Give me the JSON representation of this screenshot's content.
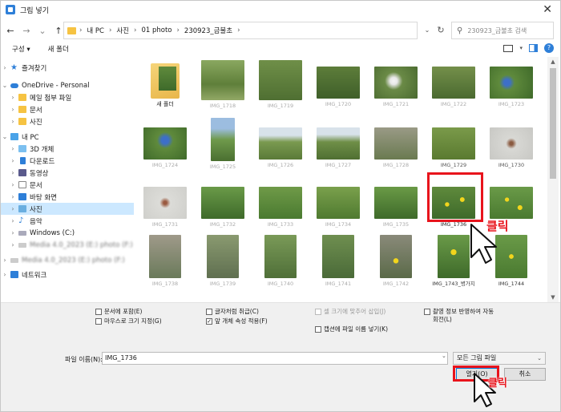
{
  "window": {
    "title": "그림 넣기"
  },
  "nav": {
    "back": "←",
    "forward": "→",
    "recent": "⌄",
    "up": "↑",
    "breadcrumb": [
      "내 PC",
      "사진",
      "01 photo",
      "230923_금불초"
    ],
    "refresh": "↻",
    "search_placeholder": "230923_금불초 검색"
  },
  "toolbar": {
    "organize": "구성 ▾",
    "new_folder": "새 폴더"
  },
  "sidebar": {
    "items": [
      {
        "label": "즐겨찾기",
        "icon": "star-icon"
      },
      {
        "label": "OneDrive - Personal",
        "icon": "cloud-icon"
      },
      {
        "label": "메일 첨부 파일",
        "icon": "folder-icon"
      },
      {
        "label": "문서",
        "icon": "folder-icon"
      },
      {
        "label": "사진",
        "icon": "folder-icon"
      },
      {
        "label": "내 PC",
        "icon": "computer-icon"
      },
      {
        "label": "3D 개체",
        "icon": "cube-icon"
      },
      {
        "label": "다운로드",
        "icon": "download-icon"
      },
      {
        "label": "동영상",
        "icon": "video-icon"
      },
      {
        "label": "문서",
        "icon": "document-icon"
      },
      {
        "label": "바탕 화면",
        "icon": "desktop-icon"
      },
      {
        "label": "사진",
        "icon": "pictures-icon"
      },
      {
        "label": "음악",
        "icon": "music-icon"
      },
      {
        "label": "Windows (C:)",
        "icon": "drive-icon"
      },
      {
        "label": "Media 4.0_2023 (E:) photo (F:)",
        "icon": "drive-icon"
      },
      {
        "label": "Media 4.0_2023 (E:) photo (F:)",
        "icon": "drive-icon"
      },
      {
        "label": "네트워크",
        "icon": "network-icon"
      }
    ]
  },
  "files": [
    {
      "label": "새 폴더"
    },
    {
      "label": "IMG_1718"
    },
    {
      "label": "IMG_1719"
    },
    {
      "label": "IMG_1720"
    },
    {
      "label": "IMG_1721"
    },
    {
      "label": "IMG_1722"
    },
    {
      "label": "IMG_1723"
    },
    {
      "label": "IMG_1724"
    },
    {
      "label": "IMG_1725"
    },
    {
      "label": "IMG_1726"
    },
    {
      "label": "IMG_1727"
    },
    {
      "label": "IMG_1728"
    },
    {
      "label": "IMG_1729"
    },
    {
      "label": "IMG_1730"
    },
    {
      "label": "IMG_1731"
    },
    {
      "label": "IMG_1732"
    },
    {
      "label": "IMG_1733"
    },
    {
      "label": "IMG_1734"
    },
    {
      "label": "IMG_1735"
    },
    {
      "label": "IMG_1736"
    },
    {
      "label": ""
    },
    {
      "label": "IMG_1738"
    },
    {
      "label": "IMG_1739"
    },
    {
      "label": "IMG_1740"
    },
    {
      "label": "IMG_1741"
    },
    {
      "label": "IMG_1742"
    },
    {
      "label": "IMG_1743_병가지"
    },
    {
      "label": "IMG_1744"
    }
  ],
  "options": {
    "opt1": "문서에 포함(E)",
    "opt2": "마우스로 크기 지정(G)",
    "opt3": "글자처럼 취급(C)",
    "opt4": "앞 개체 속성 적용(F)",
    "opt5": "셀 크기에 맞추어 삽입(J)",
    "opt6": "캡션에 파일 이름 넣기(K)",
    "opt7": "촬영 정보 반영하여 자동 회전(L)"
  },
  "bottom": {
    "filename_label": "파일 이름(N):",
    "filename_value": "IMG_1736",
    "filter": "모든 그림 파일",
    "open": "열기(O)",
    "cancel": "취소"
  },
  "annotations": {
    "click1": "클릭",
    "click2": "클릭"
  },
  "colors": {
    "accent": "#0078d7",
    "highlight": "#e8141c",
    "selection": "#cce8ff"
  }
}
